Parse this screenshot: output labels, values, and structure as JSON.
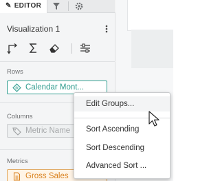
{
  "tabs": {
    "editor_label": "EDITOR",
    "filter_icon": "filter-icon",
    "settings_icon": "gear-icon"
  },
  "visualization": {
    "title": "Visualization 1",
    "menu_icon": "kebab-menu-icon"
  },
  "toolbar": {
    "icons": [
      "swap-axes-icon",
      "sigma-icon",
      "eraser-icon",
      "options-sliders-icon"
    ]
  },
  "rows": {
    "label": "Rows",
    "item": "Calendar Mont...",
    "item_icon": "formula-fx-icon",
    "accent": "#2f9d8f"
  },
  "columns": {
    "label": "Columns",
    "item": "Metric Name",
    "item_icon": "tag-icon"
  },
  "metrics": {
    "label": "Metrics",
    "item": "Gross Sales",
    "item_icon": "document-icon",
    "accent": "#e0a55a"
  },
  "context_menu": {
    "edit_groups": "Edit Groups...",
    "sort_ascending": "Sort Ascending",
    "sort_descending": "Sort Descending",
    "advanced_sort": "Advanced Sort ..."
  }
}
